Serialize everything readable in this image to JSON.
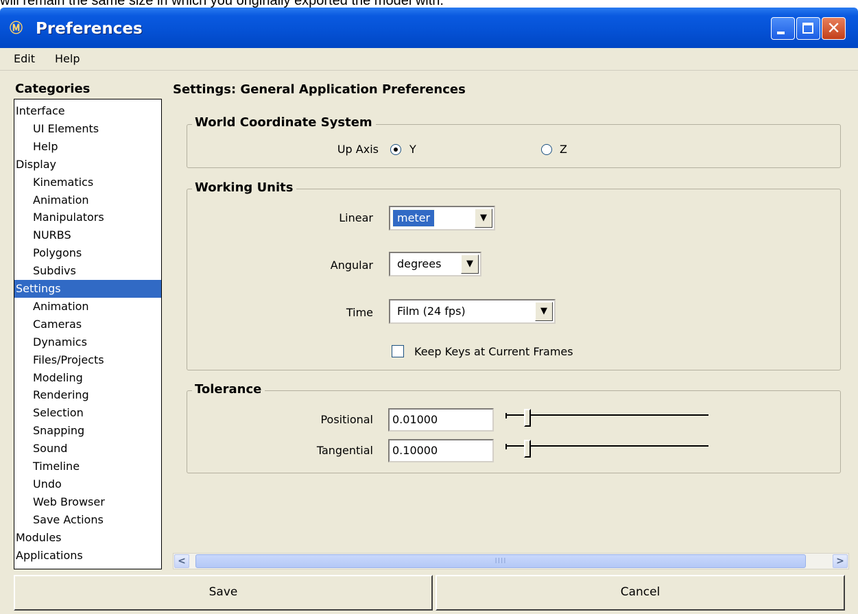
{
  "top_cut_text": "will remain the same size in which you originally exported the model with.",
  "window": {
    "title": "Preferences",
    "app_icon": "Ⓜ"
  },
  "title_buttons": {
    "close_glyph": "✕"
  },
  "menu": [
    "Edit",
    "Help"
  ],
  "categories": {
    "label": "Categories",
    "items": [
      {
        "label": "Interface",
        "level": 0
      },
      {
        "label": "UI Elements",
        "level": 1
      },
      {
        "label": "Help",
        "level": 1
      },
      {
        "label": "Display",
        "level": 0
      },
      {
        "label": "Kinematics",
        "level": 1
      },
      {
        "label": "Animation",
        "level": 1
      },
      {
        "label": "Manipulators",
        "level": 1
      },
      {
        "label": "NURBS",
        "level": 1
      },
      {
        "label": "Polygons",
        "level": 1
      },
      {
        "label": "Subdivs",
        "level": 1
      },
      {
        "label": "Settings",
        "level": 0,
        "selected": true
      },
      {
        "label": "Animation",
        "level": 1
      },
      {
        "label": "Cameras",
        "level": 1
      },
      {
        "label": "Dynamics",
        "level": 1
      },
      {
        "label": "Files/Projects",
        "level": 1
      },
      {
        "label": "Modeling",
        "level": 1
      },
      {
        "label": "Rendering",
        "level": 1
      },
      {
        "label": "Selection",
        "level": 1
      },
      {
        "label": "Snapping",
        "level": 1
      },
      {
        "label": "Sound",
        "level": 1
      },
      {
        "label": "Timeline",
        "level": 1
      },
      {
        "label": "Undo",
        "level": 1
      },
      {
        "label": "Web Browser",
        "level": 1
      },
      {
        "label": "Save Actions",
        "level": 1
      },
      {
        "label": "Modules",
        "level": 0
      },
      {
        "label": "Applications",
        "level": 0
      }
    ]
  },
  "settings": {
    "heading": "Settings: General Application Preferences",
    "world": {
      "title": "World Coordinate System",
      "up_axis_label": "Up Axis",
      "options": [
        {
          "label": "Y",
          "selected": true
        },
        {
          "label": "Z",
          "selected": false
        }
      ]
    },
    "units": {
      "title": "Working Units",
      "linear_label": "Linear",
      "linear_value": "meter",
      "angular_label": "Angular",
      "angular_value": "degrees",
      "time_label": "Time",
      "time_value": "Film (24 fps)",
      "keep_keys_label": "Keep Keys at Current Frames",
      "keep_keys_checked": false
    },
    "tolerance": {
      "title": "Tolerance",
      "positional_label": "Positional",
      "positional_value": "0.01000",
      "positional_slider": 0.05,
      "tangential_label": "Tangential",
      "tangential_value": "0.10000",
      "tangential_slider": 0.05
    }
  },
  "scrollbar": {
    "left_glyph": "<",
    "right_glyph": ">",
    "grip": "IIII"
  },
  "buttons": {
    "save": "Save",
    "cancel": "Cancel"
  },
  "dropdown_arrow": "▼"
}
